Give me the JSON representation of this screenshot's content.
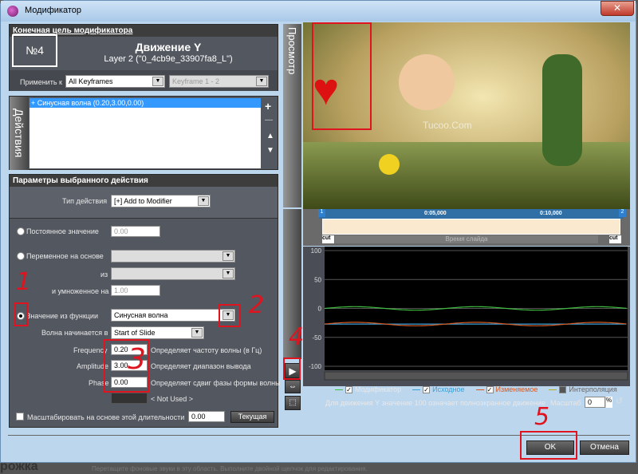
{
  "window": {
    "title": "Модификатор",
    "close": "✕"
  },
  "target": {
    "header": "Конечная цель модификатора",
    "number": "№4",
    "name": "Движение Y",
    "layer": "Layer 2 (\"0_4cb9e_33907fa8_L\")",
    "apply_label": "Применить к",
    "apply_value": "All Keyframes",
    "keyframe_value": "Keyframe 1 - 2"
  },
  "actions": {
    "tab_label": "Действия",
    "items": [
      "+ Синусная волна (0.20,3.00,0.00)"
    ],
    "add": "+",
    "remove": "—",
    "up": "▲",
    "down": "▼"
  },
  "params": {
    "header": "Параметры выбранного действия",
    "type_label": "Тип действия",
    "type_value": "[+] Add to Modifier",
    "constant_label": "Постоянное значение",
    "constant_value": "0.00",
    "variable_label": "Переменное на основе",
    "from_label": "из",
    "mult_label": "и умноженное на",
    "mult_value": "1.00",
    "function_label": "Значение из функции",
    "function_value": "Синусная волна",
    "wave_start_label": "Волна начинается в",
    "wave_start_value": "Start of Slide",
    "frequency_label": "Frequency",
    "frequency_value": "0.20",
    "frequency_desc": "Определяет частоту волны (в Гц)",
    "amplitude_label": "Amplitude",
    "amplitude_value": "3.00",
    "amplitude_desc": "Определяет диапазон вывода",
    "phase_label": "Phase",
    "phase_value": "0.00",
    "phase_desc": "Определяет сдвиг фазы формы волны",
    "not_used": "< Not Used >",
    "scale_label": "Масштабировать на основе этой длительности",
    "scale_value": "0.00",
    "current_button": "Текущая"
  },
  "preview": {
    "tab_label": "Просмотр",
    "watermark": "Tucoo.Com"
  },
  "timeline": {
    "marker_start": "1",
    "marker_end": "2",
    "ticks": [
      "0:05,000",
      "0:10,000"
    ],
    "cut_left": "cut",
    "cut_right": "cut",
    "label": "Время слайда"
  },
  "chart_data": {
    "type": "line",
    "yticks": [
      100,
      50,
      0,
      -50,
      -100
    ],
    "ylim": [
      -100,
      100
    ],
    "xlim": [
      0,
      12.5
    ],
    "series": [
      {
        "name": "Модификатор",
        "color": "#3fbf3f",
        "offset": 0,
        "amplitude": 3,
        "frequency": 0.2
      },
      {
        "name": "Исходное",
        "color": "#3aa0d8",
        "offset": -27,
        "amplitude": 0,
        "frequency": 0
      },
      {
        "name": "Изменяемое",
        "color": "#d85a20",
        "offset": -27,
        "amplitude": 3,
        "frequency": 0.2
      },
      {
        "name": "Интерполяция",
        "color": "#b0b020",
        "offset": null,
        "amplitude": 0,
        "frequency": 0
      }
    ]
  },
  "legend": {
    "items": [
      {
        "label": "Модификатор",
        "checked": true,
        "color": "#3fbf3f",
        "text_color": "#e8e8e8"
      },
      {
        "label": "Исходное",
        "checked": true,
        "color": "#3aa0d8",
        "text_color": "#3aa0d8"
      },
      {
        "label": "Изменяемое",
        "checked": true,
        "color": "#d85a20",
        "text_color": "#d85a20"
      },
      {
        "label": "Интерполяция",
        "checked": false,
        "color": "#b0b020",
        "text_color": "#666"
      }
    ]
  },
  "footer": {
    "caption": "Для движения Y значение 100 означает полноэкранное движение",
    "scale_label": "Масштаб",
    "scale_value": "0",
    "percent": "%",
    "ok": "OK",
    "cancel": "Отмена"
  },
  "annotations": [
    "1",
    "2",
    "3",
    "4",
    "5"
  ],
  "background_strip": {
    "title": "рожка",
    "hint": "Перетащите фоновые звуки в эту область. Выполните двойной щелчок для редактирования."
  }
}
